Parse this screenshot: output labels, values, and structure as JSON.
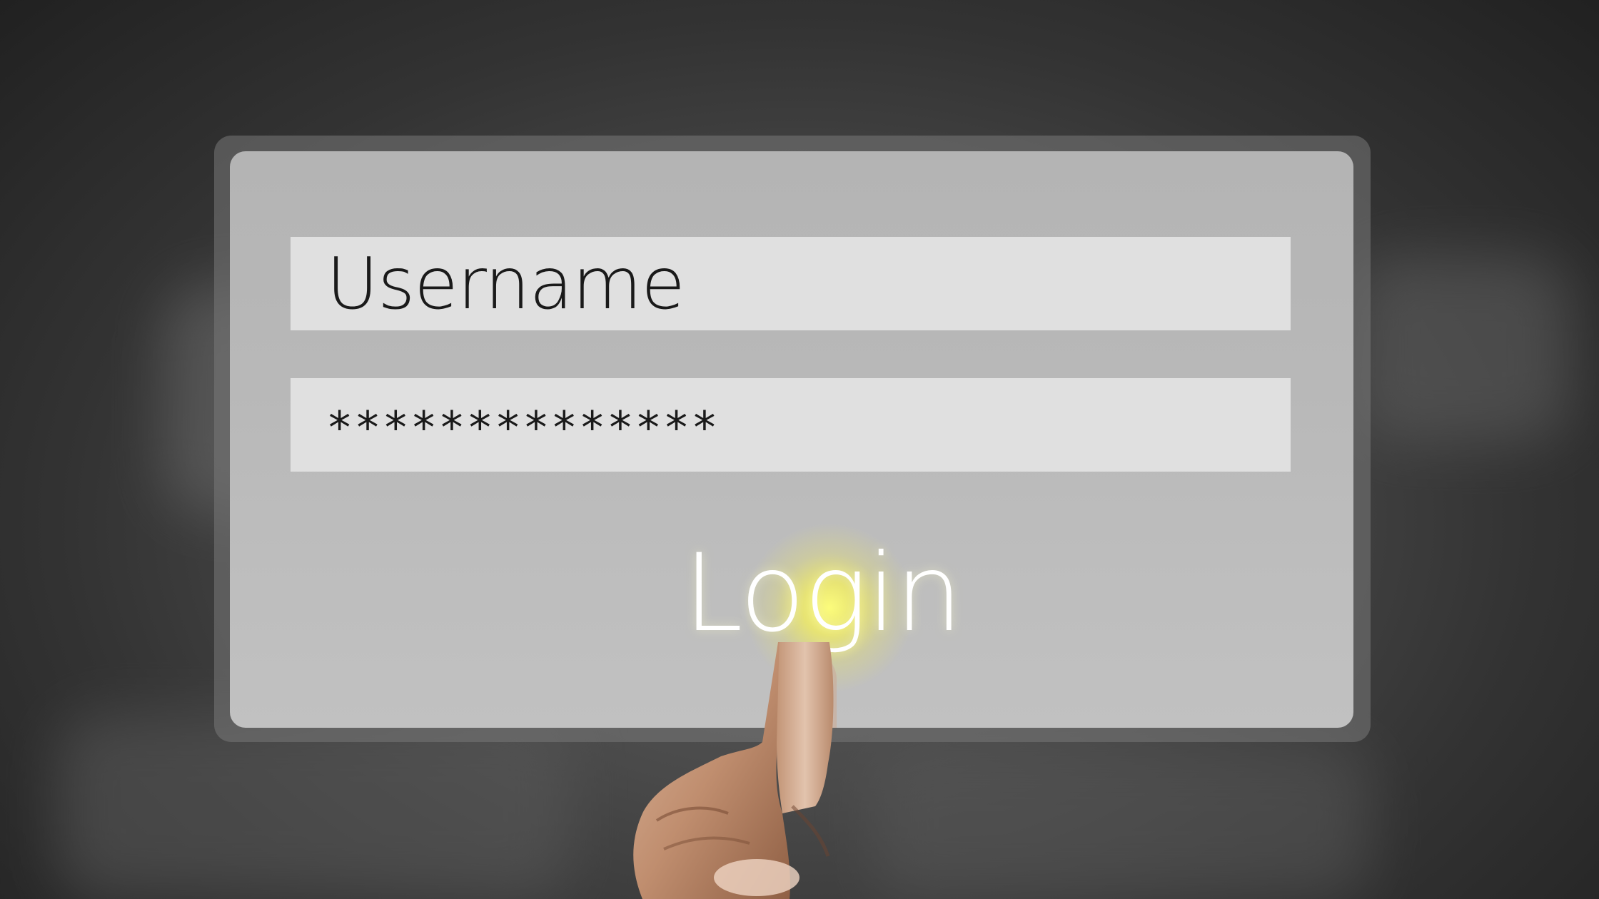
{
  "login_form": {
    "username_text": "Username",
    "password_text": "**************",
    "login_label": "Login"
  },
  "colors": {
    "background": "#2a2a2a",
    "panel": "#bababa",
    "field": "#e0e0e0",
    "glow": "#f5f05a",
    "login_text": "#ffffff"
  }
}
